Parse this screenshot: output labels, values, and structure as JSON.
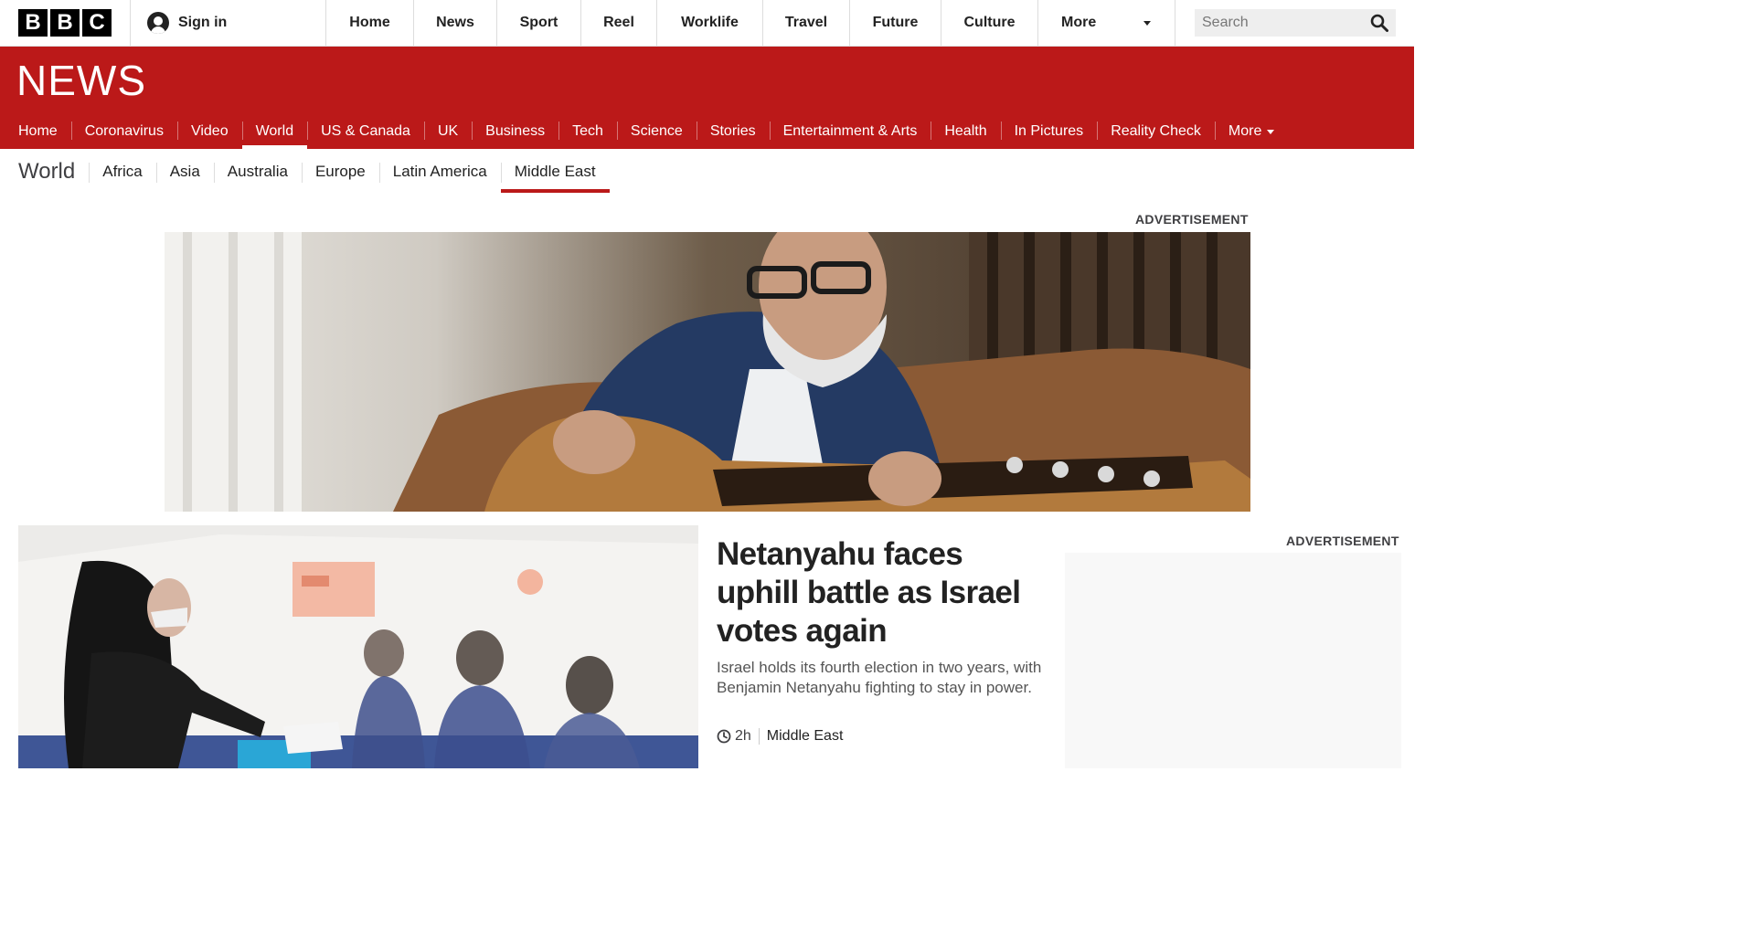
{
  "masthead": {
    "logo_letters": [
      "B",
      "B",
      "C"
    ],
    "sign_in_label": "Sign in",
    "nav": [
      "Home",
      "News",
      "Sport",
      "Reel",
      "Worklife",
      "Travel",
      "Future",
      "Culture"
    ],
    "more_label": "More",
    "search_placeholder": "Search"
  },
  "news_band": {
    "wordmark": "NEWS",
    "nav": [
      {
        "label": "Home",
        "active": false
      },
      {
        "label": "Coronavirus",
        "active": false
      },
      {
        "label": "Video",
        "active": false
      },
      {
        "label": "World",
        "active": true
      },
      {
        "label": "US & Canada",
        "active": false
      },
      {
        "label": "UK",
        "active": false
      },
      {
        "label": "Business",
        "active": false
      },
      {
        "label": "Tech",
        "active": false
      },
      {
        "label": "Science",
        "active": false
      },
      {
        "label": "Stories",
        "active": false
      },
      {
        "label": "Entertainment & Arts",
        "active": false
      },
      {
        "label": "Health",
        "active": false
      },
      {
        "label": "In Pictures",
        "active": false
      },
      {
        "label": "Reality Check",
        "active": false
      }
    ],
    "more_label": "More"
  },
  "world_nav": {
    "title": "World",
    "items": [
      {
        "label": "Africa",
        "active": false
      },
      {
        "label": "Asia",
        "active": false
      },
      {
        "label": "Australia",
        "active": false
      },
      {
        "label": "Europe",
        "active": false
      },
      {
        "label": "Latin America",
        "active": false
      },
      {
        "label": "Middle East",
        "active": true
      }
    ]
  },
  "ads": {
    "banner_label": "ADVERTISEMENT",
    "side_label": "ADVERTISEMENT"
  },
  "lead_story": {
    "headline": "Netanyahu faces uphill battle as Israel votes again",
    "summary": "Israel holds its fourth election in two years, with Benjamin Netanyahu fighting to stay in power.",
    "time": "2h",
    "section": "Middle East"
  },
  "colors": {
    "brand_red": "#bb1919",
    "text_dark": "#222222",
    "text_muted": "#555555"
  }
}
